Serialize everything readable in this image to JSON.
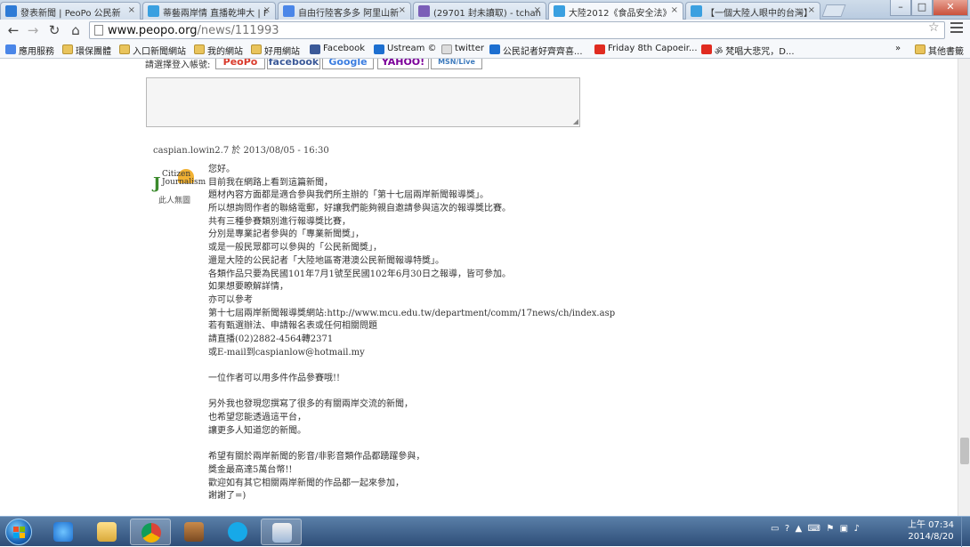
{
  "browser": {
    "tabs": [
      {
        "label": "發表新聞 | PeoPo 公民新",
        "favicon": "#2e7bd6"
      },
      {
        "label": "蒂藝兩岸情 直播乾坤大 | F",
        "favicon": "#3aa0e0"
      },
      {
        "label": "自由行陸客多多 阿里山新",
        "favicon": "#4a86e8"
      },
      {
        "label": "(29701 封未讀取) - tchan",
        "favicon": "#7b5fb8"
      },
      {
        "label": "大陸2012《食品安全法》",
        "favicon": "#3aa0e0"
      },
      {
        "label": "【一個大陸人眼中的台灣】",
        "favicon": "#3aa0e0"
      }
    ],
    "active_tab": 4,
    "url_host": "www.peopo.org",
    "url_path": "/news/111993",
    "bookmarks": [
      {
        "label": "應用服務",
        "icon": "apps"
      },
      {
        "label": "環保團體",
        "icon": "folder"
      },
      {
        "label": "入口新聞網站",
        "icon": "folder"
      },
      {
        "label": "我的網站",
        "icon": "folder"
      },
      {
        "label": "好用網站",
        "icon": "folder"
      },
      {
        "label": "Facebook",
        "icon": "facebook"
      },
      {
        "label": "Ustream ©",
        "icon": "ustream"
      },
      {
        "label": "twitter",
        "icon": "page"
      },
      {
        "label": "公民記者好齊齊喜...",
        "icon": "ustream"
      },
      {
        "label": "Friday 8th Capoeir...",
        "icon": "youtube"
      },
      {
        "label": "ॐ 梵唱大悲咒，D...",
        "icon": "youtube"
      },
      {
        "label": "»",
        "icon": "none"
      },
      {
        "label": "其他書籤",
        "icon": "folder"
      }
    ]
  },
  "page": {
    "share_label": "請選擇登入帳號:",
    "share_buttons": [
      "PeoPo",
      "facebook",
      "Google",
      "YAHOO!",
      "MSN/Live"
    ],
    "comment": {
      "meta": "caspian.lowin2.7 於 2013/08/05 - 16:30",
      "avatar_text_1": "Citizen",
      "avatar_text_2": "Journalism",
      "avatar_sub": "此人無圖",
      "lines": [
        "您好。",
        "目前我在網路上看到這篇新聞，",
        "題材內容方面都是適合參與我們所主辦的「第十七屆兩岸新聞報導獎」。",
        "所以想詢問作者的聯絡電郵，好讓我們能夠親自邀請參與這次的報導獎比賽。",
        "共有三種參賽類別進行報導獎比賽，",
        "分別是專業記者參與的「專業新聞獎」，",
        "或是一般民眾都可以參與的「公民新聞獎」，",
        "還是大陸的公民記者「大陸地區寄港澳公民新聞報導特獎」。",
        "各類作品只要為民國101年7月1號至民國102年6月30日之報導，皆可參加。",
        "如果想要瞭解詳情，",
        "亦可以參考",
        "第十七屆兩岸新聞報導獎網站:http://www.mcu.edu.tw/department/comm/17news/ch/index.asp",
        "若有甄選辦法、申請報名表或任何相關問題",
        "請直播(02)2882-4564轉2371",
        "或E-mail到caspianlow@hotmail.my",
        "",
        "一位作者可以用多件作品參賽哦!!",
        "",
        "另外我也發現您撰寫了很多的有關兩岸交流的新聞，",
        "也希望您能透過這平台，",
        "讓更多人知道您的新聞。",
        "",
        "希望有關於兩岸新聞的影音/非影音類作品都踴躍參與，",
        "獎金最高達5萬台幣!!",
        "歡迎如有其它相關兩岸新聞的作品都一起來參加，",
        "謝謝了=)"
      ]
    }
  },
  "taskbar": {
    "clock_time": "上午 07:34",
    "clock_date": "2014/8/20"
  }
}
